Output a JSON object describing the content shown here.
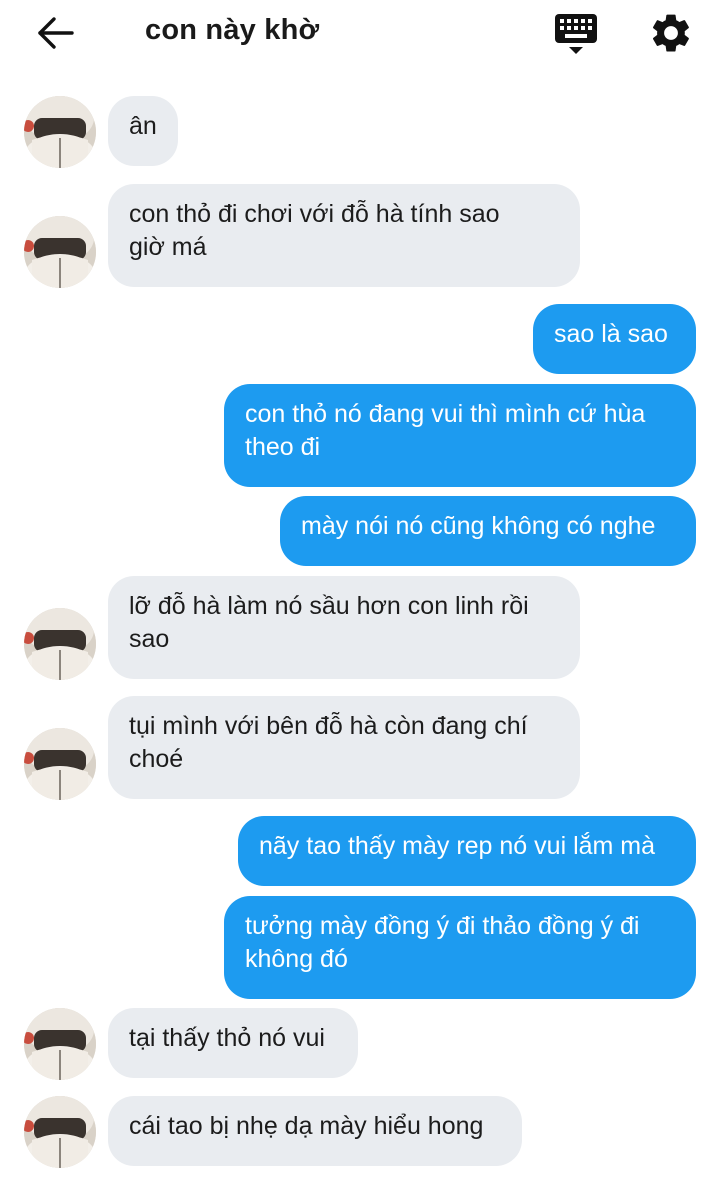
{
  "header": {
    "title": "con này khờ",
    "back_icon": "arrow-left-icon",
    "keyboard_icon": "keyboard-icon",
    "settings_icon": "gear-icon"
  },
  "colors": {
    "incoming_bubble": "#e9ecf0",
    "outgoing_bubble": "#1d9bf0"
  },
  "messages": [
    {
      "side": "in",
      "text": "ân"
    },
    {
      "side": "in",
      "text": "con thỏ đi chơi với đỗ hà tính sao\ngiờ má"
    },
    {
      "side": "out",
      "text": "sao là sao"
    },
    {
      "side": "out",
      "text": "con thỏ nó đang vui thì mình cứ hùa\ntheo đi"
    },
    {
      "side": "out",
      "text": "mày nói nó cũng không có nghe"
    },
    {
      "side": "in",
      "text": "lỡ đỗ hà làm nó sầu hơn con linh rồi\nsao"
    },
    {
      "side": "in",
      "text": "tụi mình với bên đỗ hà còn đang chí\nchoé"
    },
    {
      "side": "out",
      "text": "nãy tao thấy mày rep nó vui lắm mà"
    },
    {
      "side": "out",
      "text": "tưởng mày đồng ý đi thảo đồng ý đi\nkhông đó"
    },
    {
      "side": "in",
      "text": "tại thấy thỏ nó vui"
    },
    {
      "side": "in",
      "text": "cái tao bị nhẹ dạ mày hiểu hong"
    }
  ]
}
